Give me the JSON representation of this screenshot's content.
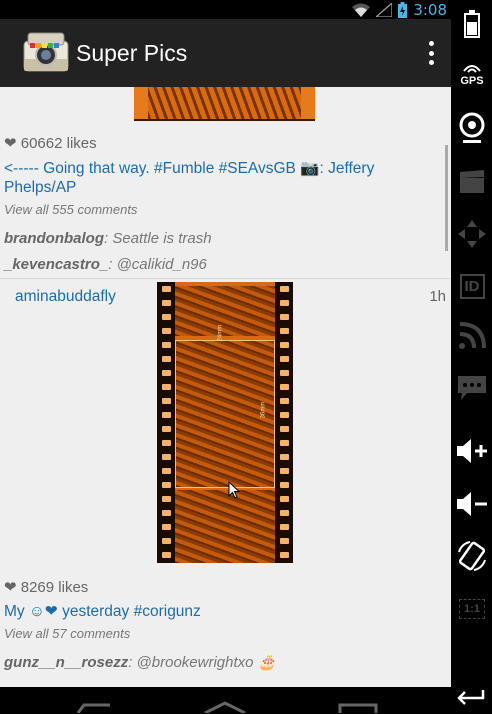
{
  "status_bar": {
    "time": "3:08"
  },
  "action_bar": {
    "title": "Super Pics"
  },
  "feed": {
    "post1": {
      "likes": "❤ 60662 likes",
      "caption": "<----- Going that way. #Fumble #SEAvsGB 📷: Jeffery Phelps/AP",
      "view_comments": "View all 555 comments",
      "comments": [
        {
          "user": "brandonbalog",
          "text": ": Seattle is trash"
        },
        {
          "user": "_kevencastro_",
          "text": ": @calikid_n96"
        }
      ]
    },
    "post2": {
      "username": "aminabuddafly",
      "time_ago": "1h",
      "film_marks": [
        "24mm",
        "36mm"
      ],
      "likes": "❤ 8269 likes",
      "caption": "My ☺❤  yesterday #corigunz",
      "view_comments": "View all 57 comments",
      "comments": [
        {
          "user": "gunz__n__rosezz",
          "text": ": @brookewrightxo 🎂"
        }
      ]
    }
  },
  "side_bar": {
    "gps_label": "GPS",
    "id_label": "ID",
    "scale_label": "1:1"
  }
}
